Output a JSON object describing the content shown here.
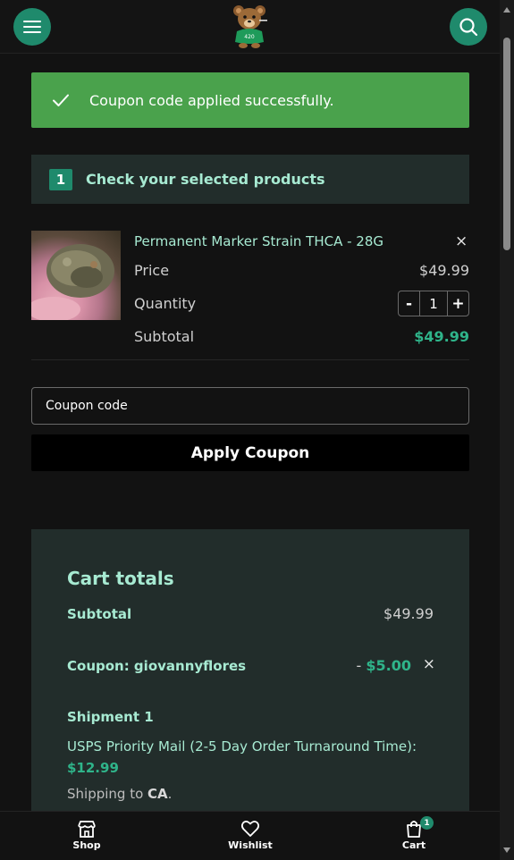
{
  "header": {
    "menu_icon": "hamburger-menu-icon",
    "logo": "teddy-bear-logo",
    "search_icon": "search-icon"
  },
  "notice": {
    "text": "Coupon code applied successfully.",
    "icon": "checkmark-icon",
    "color": "#4aa24c"
  },
  "step": {
    "number": "1",
    "title": "Check your selected products"
  },
  "product": {
    "name": "Permanent Marker Strain THCA - 28G",
    "price_label": "Price",
    "price_value": "$49.99",
    "quantity_label": "Quantity",
    "quantity_value": "1",
    "minus_label": "-",
    "plus_label": "+",
    "subtotal_label": "Subtotal",
    "subtotal_value": "$49.99",
    "remove_label": "×"
  },
  "coupon": {
    "placeholder": "Coupon code",
    "apply_label": "Apply Coupon"
  },
  "totals": {
    "title": "Cart totals",
    "subtotal_label": "Subtotal",
    "subtotal_value": "$49.99",
    "coupon_label": "Coupon: giovannyflores",
    "coupon_prefix": "- ",
    "coupon_value": "$5.00",
    "coupon_remove": "×",
    "shipment_label": "Shipment 1",
    "shipping_method": "USPS Priority Mail (2-5 Day Order Turnaround Time):",
    "shipping_price": "$12.99",
    "shipping_to_prefix": "Shipping to",
    "shipping_to_state": "CA",
    "shipping_to_suffix": "."
  },
  "bottom_nav": {
    "shop_label": "Shop",
    "wishlist_label": "Wishlist",
    "cart_label": "Cart",
    "cart_count": "1"
  },
  "colors": {
    "accent": "#1f8a6c",
    "mint_text": "#a7ead2",
    "green_price": "#2fb48a",
    "panel": "#222d2b",
    "background": "#121212"
  }
}
